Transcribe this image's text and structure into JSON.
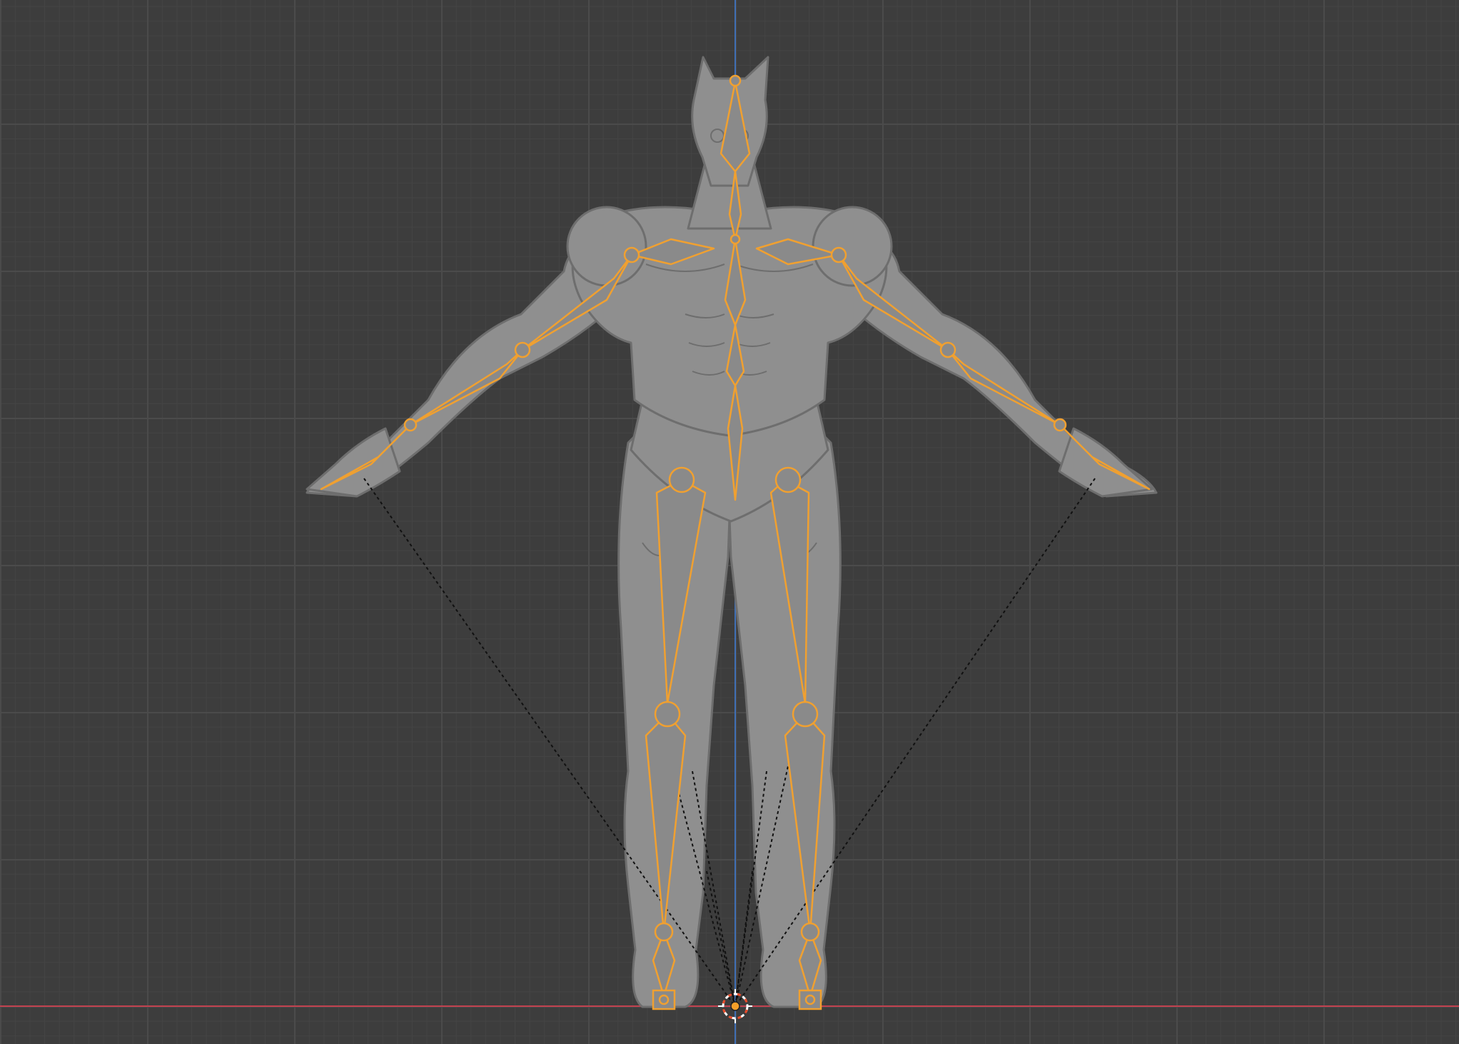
{
  "viewport": {
    "background_color": "#3d3d3d",
    "grid_minor_color": "#444444",
    "grid_major_color": "#4b4b4b",
    "x_axis_color": "#c2414f",
    "z_axis_color": "#3f6fb5"
  },
  "scene": {
    "mesh_color": "#8f8f8f",
    "mesh_shadow_color": "#6e6e6e",
    "armature_outline_color": "#f0a030",
    "armature_fill_color": "#8a8a8a",
    "ik_line_color": "#111111",
    "origin_outer_color": "#ffffff",
    "origin_inner_color": "#e84b2a",
    "objects": [
      "character-mesh",
      "armature",
      "3d-cursor"
    ]
  },
  "icons": {
    "cursor": "3d-cursor-icon",
    "foot_control_left": "foot-ik-control-icon",
    "foot_control_right": "foot-ik-control-icon"
  }
}
